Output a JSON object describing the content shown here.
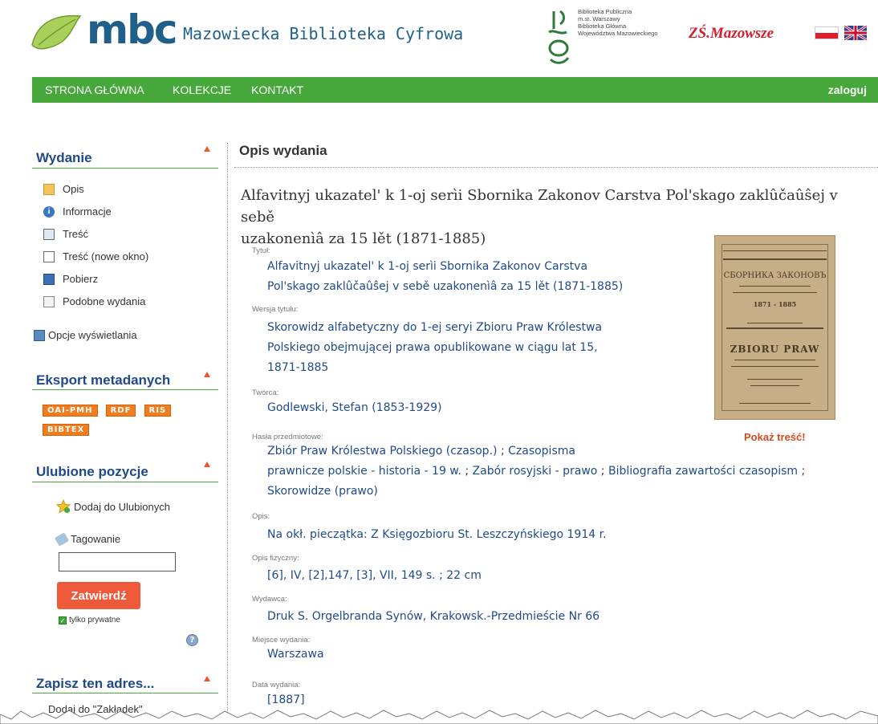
{
  "header": {
    "logo_text": "mbc",
    "site_title": "Mazowiecka Biblioteka Cyfrowa",
    "partner_lines": [
      "Biblioteka Publiczna",
      "m.st. Warszawy",
      "Biblioteka Główna",
      "Województwa Mazowieckiego"
    ],
    "mazowsze_logo": "ZŚ.Mazowsze"
  },
  "nav": {
    "items": [
      "STRONA GŁÓWNA",
      "KOLEKCJE",
      "KONTAKT"
    ],
    "login": "zaloguj"
  },
  "sidebar": {
    "wydanie": {
      "heading": "Wydanie",
      "items": [
        {
          "label": "Opis",
          "icon": "document-icon"
        },
        {
          "label": "Informacje",
          "icon": "info-icon"
        },
        {
          "label": "Treść",
          "icon": "book-icon"
        },
        {
          "label": "Treść (nowe okno)",
          "icon": "new-window-icon"
        },
        {
          "label": "Pobierz",
          "icon": "save-icon"
        },
        {
          "label": "Podobne wydania",
          "icon": "similar-icon"
        }
      ],
      "options": "Opcje wyświetlania"
    },
    "export": {
      "heading": "Eksport metadanych",
      "badges": [
        "OAI-PMH",
        "RDF",
        "RIS",
        "BIBTEX"
      ]
    },
    "favorites": {
      "heading": "Ulubione pozycje",
      "add": "Dodaj do Ulubionych",
      "tagging": "Tagowanie",
      "submit": "Zatwierdź",
      "private": "tylko prywatne",
      "help": "?"
    },
    "save_address": {
      "heading": "Zapisz ten adres...",
      "bookmark": "Dodaj do \"Zakładek\""
    }
  },
  "main": {
    "heading": "Opis wydania",
    "title_lines": [
      "Alfavitnyj ukazatel' k 1-oj serìi Sbornika Zakonov Carstva Pol'skago zaklûčaûŝej v sebě",
      "uzakonenìâ za 15 lět (1871-1885)"
    ],
    "fields": {
      "tytul": {
        "label": "Tytuł:",
        "lines": [
          "Alfavitnyj ukazatel' k 1-oj serìi Sbornika Zakonov Carstva",
          "Pol'skago zaklûčaûŝej v sebě uzakonenìâ za 15 lět (1871-1885)"
        ]
      },
      "wersja": {
        "label": "Wersja tytułu:",
        "lines": [
          "Skorowidz alfabetyczny do 1-ej seryi Zbioru Praw Królestwa",
          "Polskiego obejmującej prawa opublikowane w ciągu lat 15,",
          "1871-1885"
        ]
      },
      "tworca": {
        "label": "Twórca:",
        "value": "Godlewski, Stefan (1853-1929)"
      },
      "hasla": {
        "label": "Hasła przedmiotowe:",
        "line1": "Zbiór Praw Królestwa Polskiego (czasop.)",
        "line1b": "Czasopisma",
        "line2a": "prawnicze polskie - historia - 19 w.",
        "line2b": "Zabór rosyjski - prawo",
        "line2c": "Bibliografia zawartości czasopism",
        "line3": "Skorowidze (prawo)",
        "separator": ";"
      },
      "opis": {
        "label": "Opis:",
        "value": "Na okł. pieczątka: Z Księgozbioru St. Leszczyńskiego 1914 r."
      },
      "opis_fizyczny": {
        "label": "Opis fizyczny:",
        "value": "[6], IV, [2],147, [3], VII, 149 s. ; 22 cm"
      },
      "wydawca": {
        "label": "Wydawca:",
        "value": "Druk S. Orgelbranda Synów, Krakowsk.-Przedmieście Nr 66"
      },
      "miejsce": {
        "label": "Miejsce wydania:",
        "value": "Warszawa"
      },
      "data": {
        "label": "Data wydania:",
        "value": "[1887]"
      }
    },
    "cover_title": "СБОРНИКА ЗАКОНОВЪ",
    "cover_subtitle": "ZBIORU PRAW",
    "cover_year": "1871 - 1885",
    "show_content": "Pokaż treść!"
  },
  "colors": {
    "nav_green": "#46a83a",
    "link_blue": "#1f4a8a",
    "badge_orange": "#f07d1e",
    "submit_red": "#ef5a3a"
  }
}
